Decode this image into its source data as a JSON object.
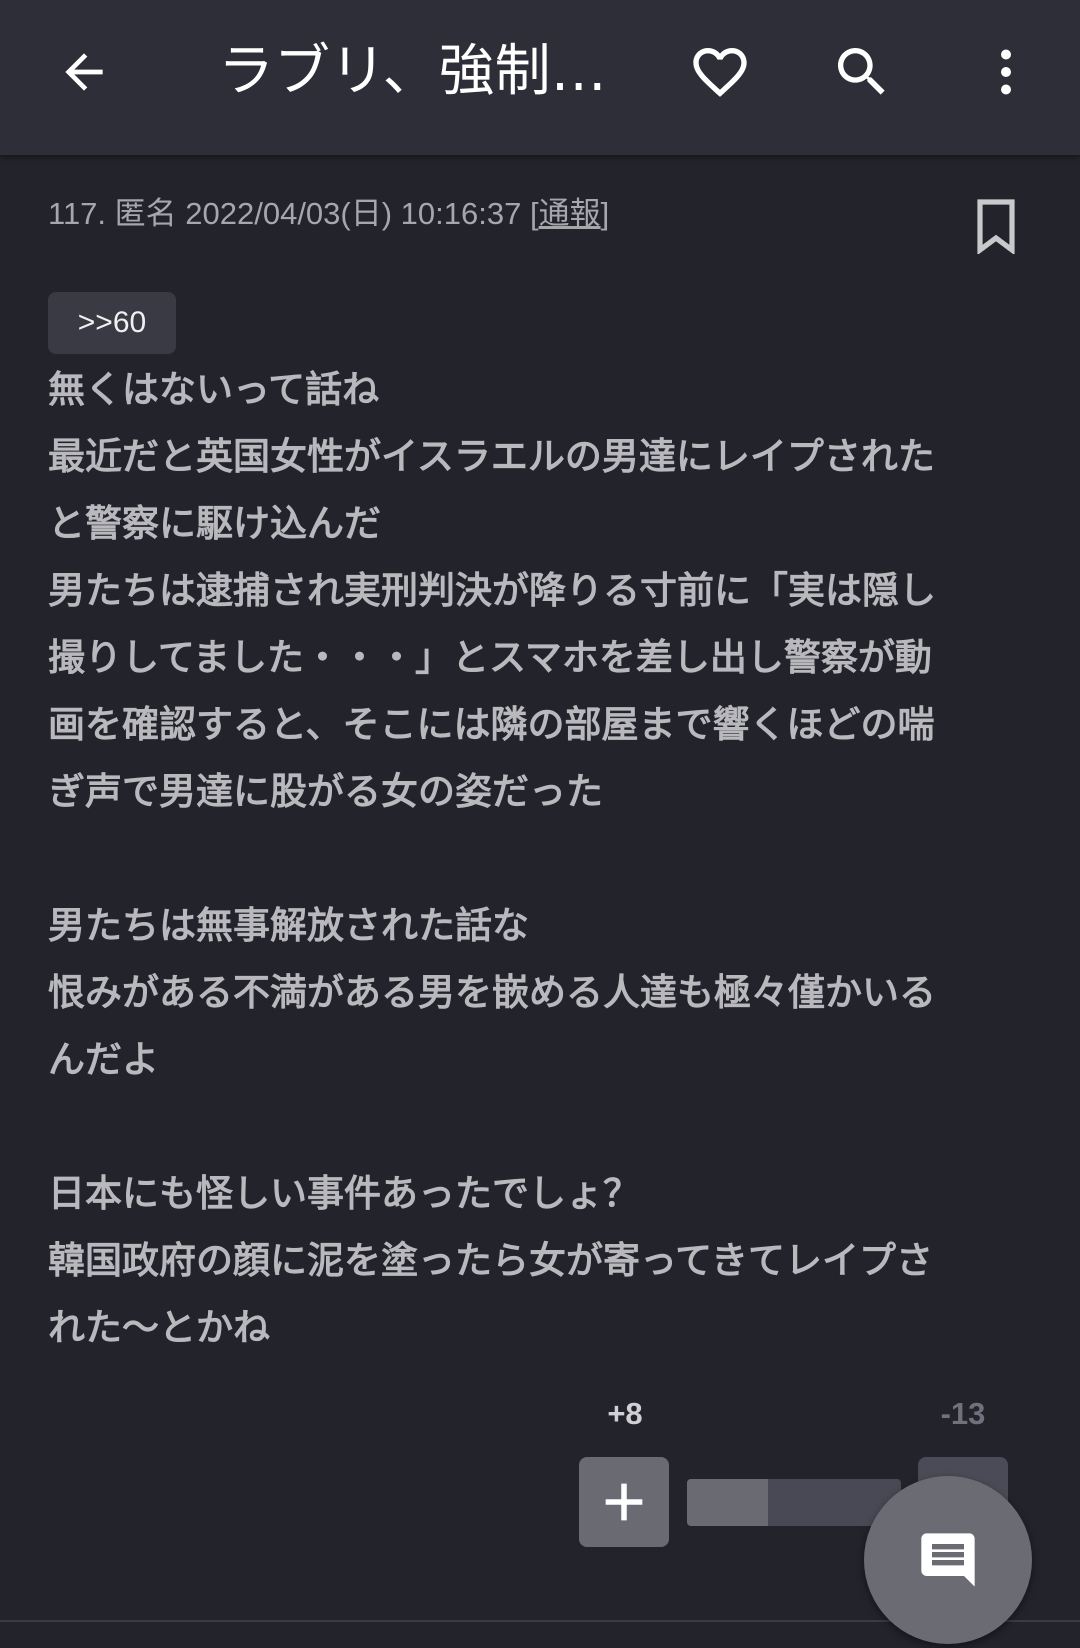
{
  "appbar": {
    "title": "ラブリ、強制…",
    "back_icon": "arrow-left-icon",
    "favorite_icon": "heart-outline-icon",
    "search_icon": "search-icon",
    "more_icon": "more-vert-icon"
  },
  "post": {
    "meta_prefix": "117. 匿名 2022/04/03(日) 10:16:37 [",
    "report_label": "通報",
    "meta_suffix": "]",
    "bookmark_icon": "bookmark-outline-icon",
    "anchor": ">>60",
    "lines": [
      "無くはないって話ね",
      "最近だと英国女性がイスラエルの男達にレイプされた",
      "と警察に駆け込んだ",
      "男たちは逮捕され実刑判決が降りる寸前に「実は隠し",
      "撮りしてました・・・」とスマホを差し出し警察が動",
      "画を確認すると、そこには隣の部屋まで響くほどの喘",
      "ぎ声で男達に股がる女の姿だった",
      "",
      "男たちは無事解放された話な",
      "恨みがある不満がある男を嵌める人達も極々僅かいる",
      "んだよ",
      "",
      "日本にも怪しい事件あったでしょ？",
      "韓国政府の顔に泥を塗ったら女が寄ってきてレイプさ",
      "れた〜とかね"
    ]
  },
  "votes": {
    "plus_count": "+8",
    "minus_count": "-13",
    "plus_fraction": 0.38
  },
  "fab": {
    "icon": "comment-icon"
  },
  "colors": {
    "background": "#22232b",
    "appbar": "#2d2e37",
    "button": "#696a72"
  }
}
